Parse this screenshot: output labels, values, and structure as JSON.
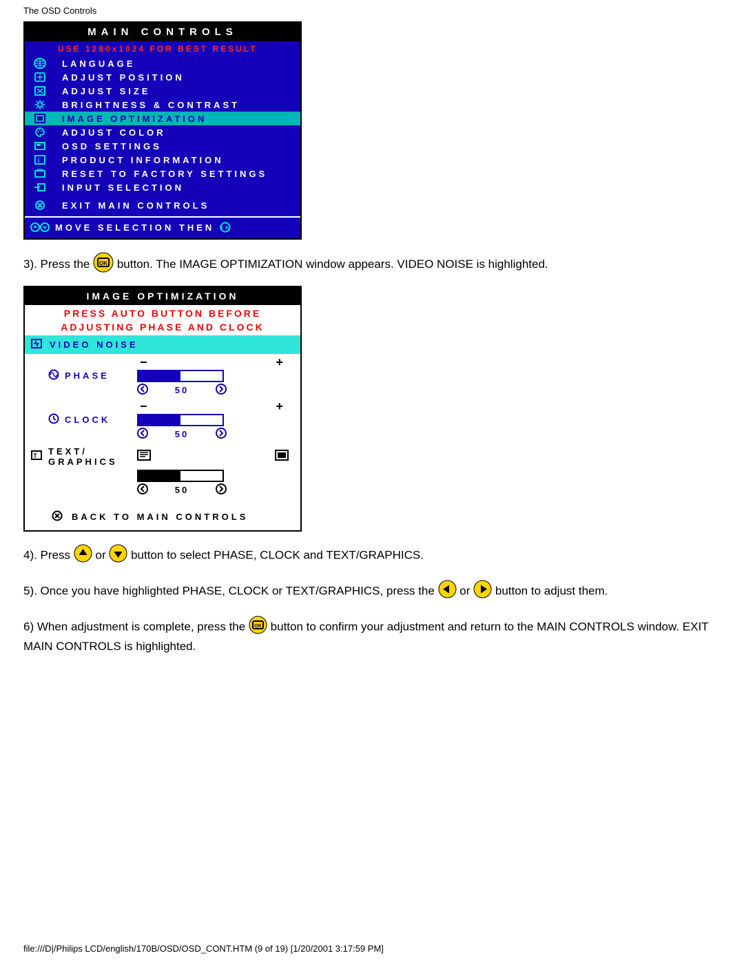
{
  "header": "The OSD Controls",
  "osd_main": {
    "title": "MAIN CONTROLS",
    "warn": "USE 1280x1024 FOR BEST RESULT",
    "items": [
      "LANGUAGE",
      "ADJUST POSITION",
      "ADJUST SIZE",
      "BRIGHTNESS & CONTRAST",
      "IMAGE OPTIMIZATION",
      "ADJUST COLOR",
      "OSD SETTINGS",
      "PRODUCT INFORMATION",
      "RESET TO FACTORY SETTINGS",
      "INPUT SELECTION"
    ],
    "exit": "EXIT MAIN CONTROLS",
    "hint": "MOVE SELECTION THEN"
  },
  "step3_a": "3). Press the ",
  "step3_b": " button. The IMAGE OPTIMIZATION window appears. VIDEO NOISE is highlighted.",
  "osd_opt": {
    "title": "IMAGE OPTIMIZATION",
    "warn1": "PRESS AUTO BUTTON BEFORE",
    "warn2": "ADJUSTING PHASE AND CLOCK",
    "video_noise": "VIDEO NOISE",
    "phase": "PHASE",
    "clock": "CLOCK",
    "text_graphics": "TEXT/ GRAPHICS",
    "back": "BACK TO MAIN CONTROLS",
    "phase_value": "50",
    "clock_value": "50",
    "tg_value": "50"
  },
  "step4_a": "4). Press",
  "step4_b": " or ",
  "step4_c": " button to select PHASE, CLOCK and TEXT/GRAPHICS.",
  "step5_a": "5). Once you have highlighted PHASE, CLOCK or TEXT/GRAPHICS, press the ",
  "step5_b": " or ",
  "step5_c": " button to adjust them.",
  "step6_a": "6) When adjustment is complete, press the ",
  "step6_b": " button to confirm your adjustment and return to the MAIN CONTROLS window.  EXIT MAIN CONTROLS is highlighted.",
  "footer": "file:///D|/Philips LCD/english/170B/OSD/OSD_CONT.HTM (9 of 19) [1/20/2001 3:17:59 PM]"
}
